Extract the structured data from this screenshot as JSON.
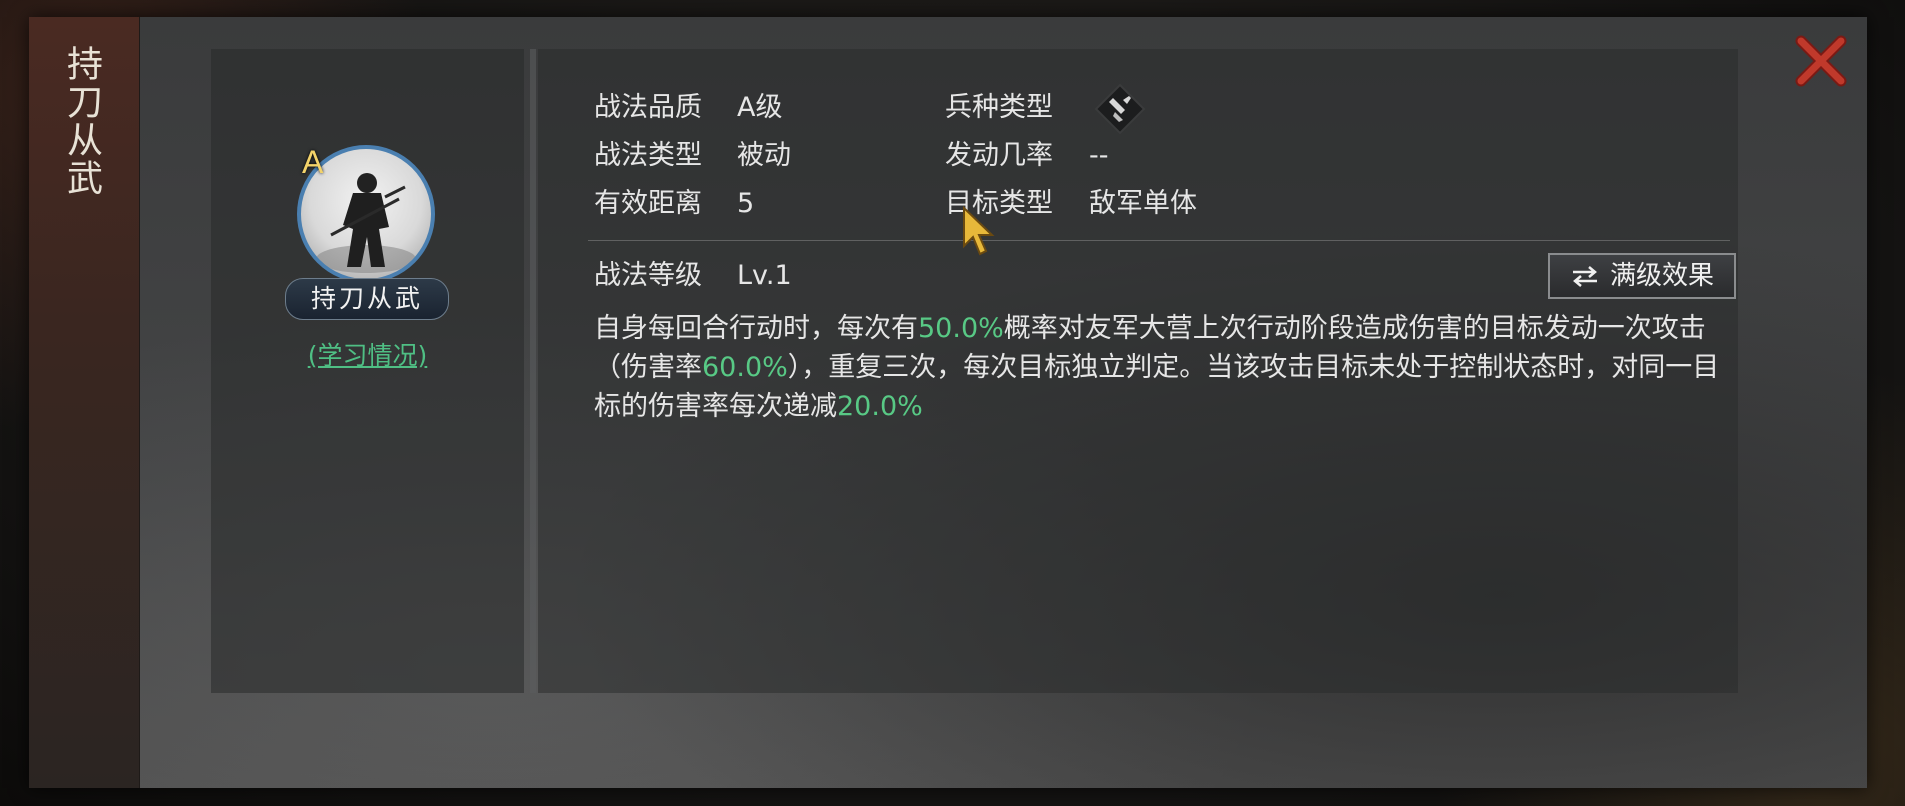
{
  "sidebar": {
    "title": "持刀从武"
  },
  "skill": {
    "grade_badge": "A",
    "name": "持刀从武",
    "study_link": "(学习情况)"
  },
  "attributes": {
    "quality_label": "战法品质",
    "quality_value": "A级",
    "type_label": "战法类型",
    "type_value": "被动",
    "range_label": "有效距离",
    "range_value": "5",
    "troop_label": "兵种类型",
    "troop_icon": "sword-troop-icon",
    "rate_label": "发动几率",
    "rate_value": "--",
    "target_label": "目标类型",
    "target_value": "敌军单体",
    "level_label": "战法等级",
    "level_value": "Lv.1"
  },
  "max_button": {
    "label": "满级效果",
    "icon": "swap-arrows-icon"
  },
  "description": {
    "seg1": "自身每回合行动时，每次有",
    "hl1": "50.0%",
    "seg2": "概率对友军大营上次行动阶段造成伤害的目标发动一次攻击（伤害率",
    "hl2": "60.0%",
    "seg3": "），重复三次，每次目标独立判定。当该攻击目标未处于控制状态时，对同一目标的伤害率每次递减",
    "hl3": "20.0%"
  },
  "colors": {
    "highlight": "#58c985",
    "link": "#4fbf84",
    "close": "#c0392b",
    "grade": "#f3d36a",
    "avatar_ring": "#4a7fb0"
  }
}
